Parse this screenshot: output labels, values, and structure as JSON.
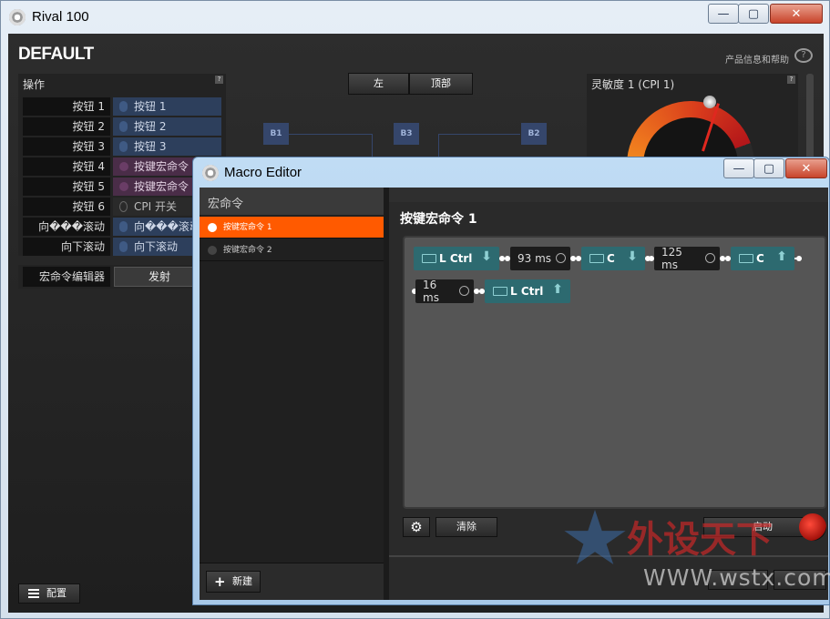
{
  "main_window": {
    "title": "Rival 100",
    "profile": "DEFAULT",
    "help_link": "产品信息和帮助",
    "operations": {
      "header": "操作",
      "help": "?",
      "rows": [
        {
          "label": "按钮 1",
          "value": "按钮 1",
          "kind": "button"
        },
        {
          "label": "按钮 2",
          "value": "按钮 2",
          "kind": "button"
        },
        {
          "label": "按钮 3",
          "value": "按钮 3",
          "kind": "button"
        },
        {
          "label": "按钮 4",
          "value": "按键宏命令",
          "kind": "macro"
        },
        {
          "label": "按钮 5",
          "value": "按键宏命令",
          "kind": "macro"
        },
        {
          "label": "按钮 6",
          "value": "CPI 开关",
          "kind": "cpi"
        },
        {
          "label": "向���滚动",
          "value": "向���滚动",
          "kind": "button"
        },
        {
          "label": "向下滚动",
          "value": "向下滚动",
          "kind": "button"
        }
      ],
      "macro_editor_label": "宏命令编辑器",
      "macro_editor_button": "发射"
    },
    "view_tabs": [
      "左",
      "顶部"
    ],
    "diagram_nodes": [
      "B1",
      "B3",
      "B2"
    ],
    "sensitivity": {
      "title": "灵敏度 1 (CPI 1)",
      "help": "?"
    },
    "config_button": "配置"
  },
  "macro_editor": {
    "title": "Macro Editor",
    "list_header": "宏命令",
    "macros": [
      {
        "name": "按键宏命令 1",
        "selected": true
      },
      {
        "name": "按键宏命令 2",
        "selected": false
      }
    ],
    "new_button": "新建",
    "current_macro": "按键宏命令 1",
    "steps": [
      {
        "type": "key",
        "key": "L Ctrl",
        "direction": "down"
      },
      {
        "type": "delay",
        "value": "93 ms"
      },
      {
        "type": "key",
        "key": "C",
        "direction": "down"
      },
      {
        "type": "delay",
        "value": "125 ms"
      },
      {
        "type": "key",
        "key": "C",
        "direction": "up"
      },
      {
        "type": "delay",
        "value": "16 ms"
      },
      {
        "type": "key",
        "key": "L Ctrl",
        "direction": "up"
      }
    ],
    "clear_button": "清除",
    "start_button": "启动"
  },
  "watermark": {
    "text": "外设天下",
    "url": "WWW.wstx.com"
  },
  "colors": {
    "accent": "#ff5a00",
    "key_step": "#2d6a70",
    "macro_row": "#4a2d48"
  }
}
